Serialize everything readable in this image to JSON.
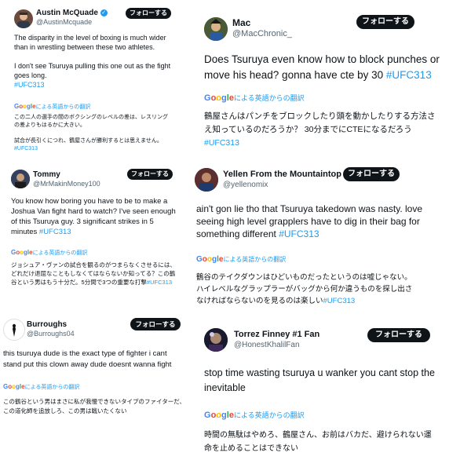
{
  "tweets": [
    {
      "name": "Austin McQuade",
      "handle": "@AustinMcquade",
      "follow": "フォローする",
      "text": "The disparity in the level of boxing is much wider than in wrestling between these two athletes.\n\nI don't see Tsuruya pulling this one out as the fight goes long.",
      "hashtag": "#UFC313",
      "translate_label": "による英語からの翻訳",
      "translation": "この二人の選手の間のボクシングのレベルの差は、レスリングの差よりもはるかに大きい。\n\n試合が長引くにつれ、鶴屋さんが勝利するとは思えません。",
      "translation_tag": "#UFC313"
    },
    {
      "name": "Mac",
      "handle": "@MacChronic_",
      "follow": "フォローする",
      "text": "Does Tsuruya even know how to block punches or move his head? gonna have cte by 30 ",
      "hashtag": "#UFC313",
      "translate_label": "による英語からの翻訳",
      "translation": "鶴屋さんはパンチをブロックしたり頭を動かしたりする方法さえ知っているのだろうか？ 30分までにCTEになるだろう",
      "translation_tag": "#UFC313"
    },
    {
      "name": "Tommy",
      "handle": "@MrMakinMoney100",
      "follow": "フォローする",
      "text": "You know how boring you have to be to make a Joshua Van fight hard to watch? I've seen enough of this Tsuruya guy. 3 significant strikes in 5 minutes ",
      "hashtag": "#UFC313",
      "translate_label": "による英語からの翻訳",
      "translation": "ジョシュア・ヴァンの試合を観るのがつまらなくさせるには、どれだけ退屈なこともしなくてはならないか知ってる？この鶴谷という男はもう十分だ。5分間で3つの重要な打撃",
      "translation_tag": "#UFC313"
    },
    {
      "name": "Yellen From the Mountaintop",
      "handle": "@yellenomix",
      "follow": "フォローする",
      "text": "ain't gon lie tho that Tsuruya takedown was nasty. love seeing high level grapplers have to dig in their bag for something different ",
      "hashtag": "#UFC313",
      "translate_label": "による英語からの翻訳",
      "translation": "鶴谷のテイクダウンはひどいものだったというのは嘘じゃない。ハイレベルなグラップラーがバッグから何か違うものを探し出さなければならないのを見るのは楽しい",
      "translation_tag": "#UFC313"
    },
    {
      "name": "Burroughs",
      "handle": "@Burroughs04",
      "follow": "フォローする",
      "text": "this tsuruya dude is the exact type of fighter i cant stand put this clown away dude doesnt wanna fight",
      "hashtag": "",
      "translate_label": "による英語からの翻訳",
      "translation": "この鶴谷という男はまさに私が我慢できないタイプのファイターだ、この道化師を追放しろ、この男は戦いたくない",
      "translation_tag": ""
    },
    {
      "name": "Torrez Finney #1 Fan",
      "handle": "@HonestKhalilFan",
      "follow": "フォローする",
      "text": "stop time wasting tsuruya u wanker you cant stop the inevitable",
      "hashtag": "",
      "translate_label": "による英語からの翻訳",
      "translation": "時間の無駄はやめろ、鶴屋さん、お前はバカだ、避けられない運命を止めることはできない",
      "translation_tag": ""
    }
  ],
  "colors": {
    "accent": "#1d9bf0",
    "follow_bg": "#0f1419",
    "secondary": "#536471"
  }
}
